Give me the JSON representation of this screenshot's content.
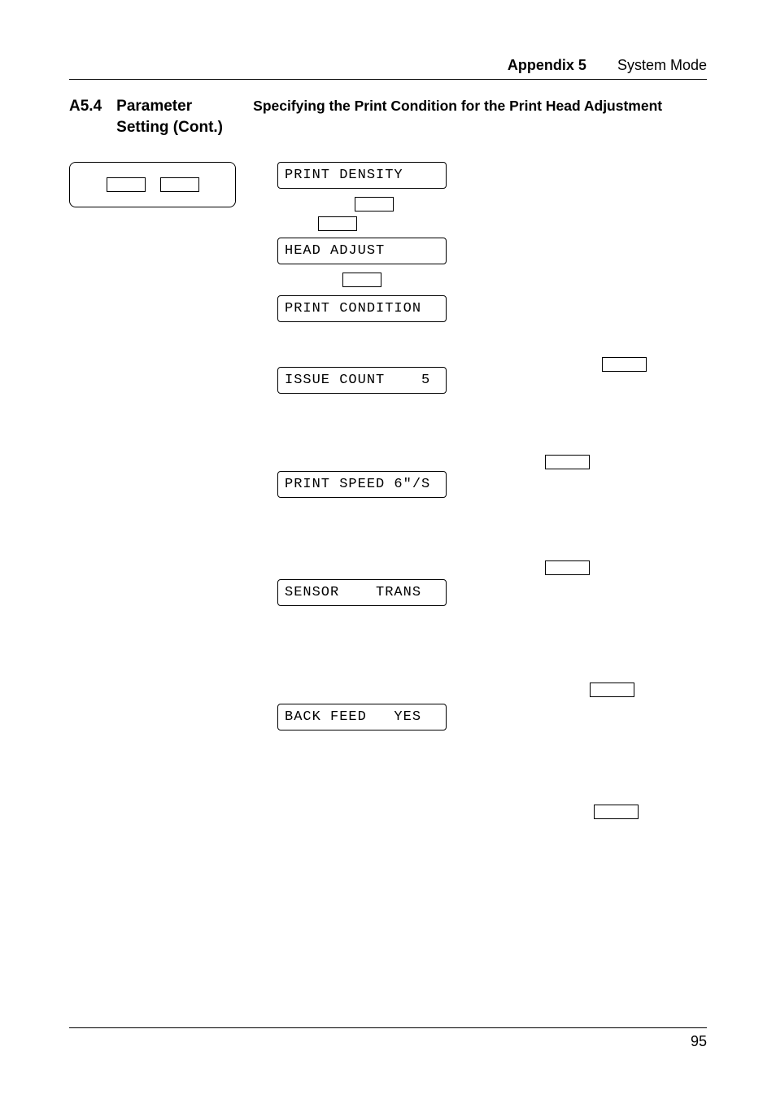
{
  "header": {
    "appendix": "Appendix 5",
    "mode": "System Mode"
  },
  "section": {
    "num": "A5.4",
    "title_l1": "Parameter",
    "title_l2": "Setting (Cont.)"
  },
  "spec_title": "Specifying the Print Condition for the Print Head Adjustment",
  "lcd": {
    "print_density": "PRINT DENSITY",
    "head_adjust": "HEAD ADJUST",
    "print_cond": "PRINT CONDITION",
    "issue_count": "ISSUE COUNT    5",
    "print_speed": "PRINT SPEED 6\"/S",
    "sensor": "SENSOR    TRANS",
    "back_feed": "BACK FEED   YES"
  },
  "footer": {
    "page": "95"
  }
}
